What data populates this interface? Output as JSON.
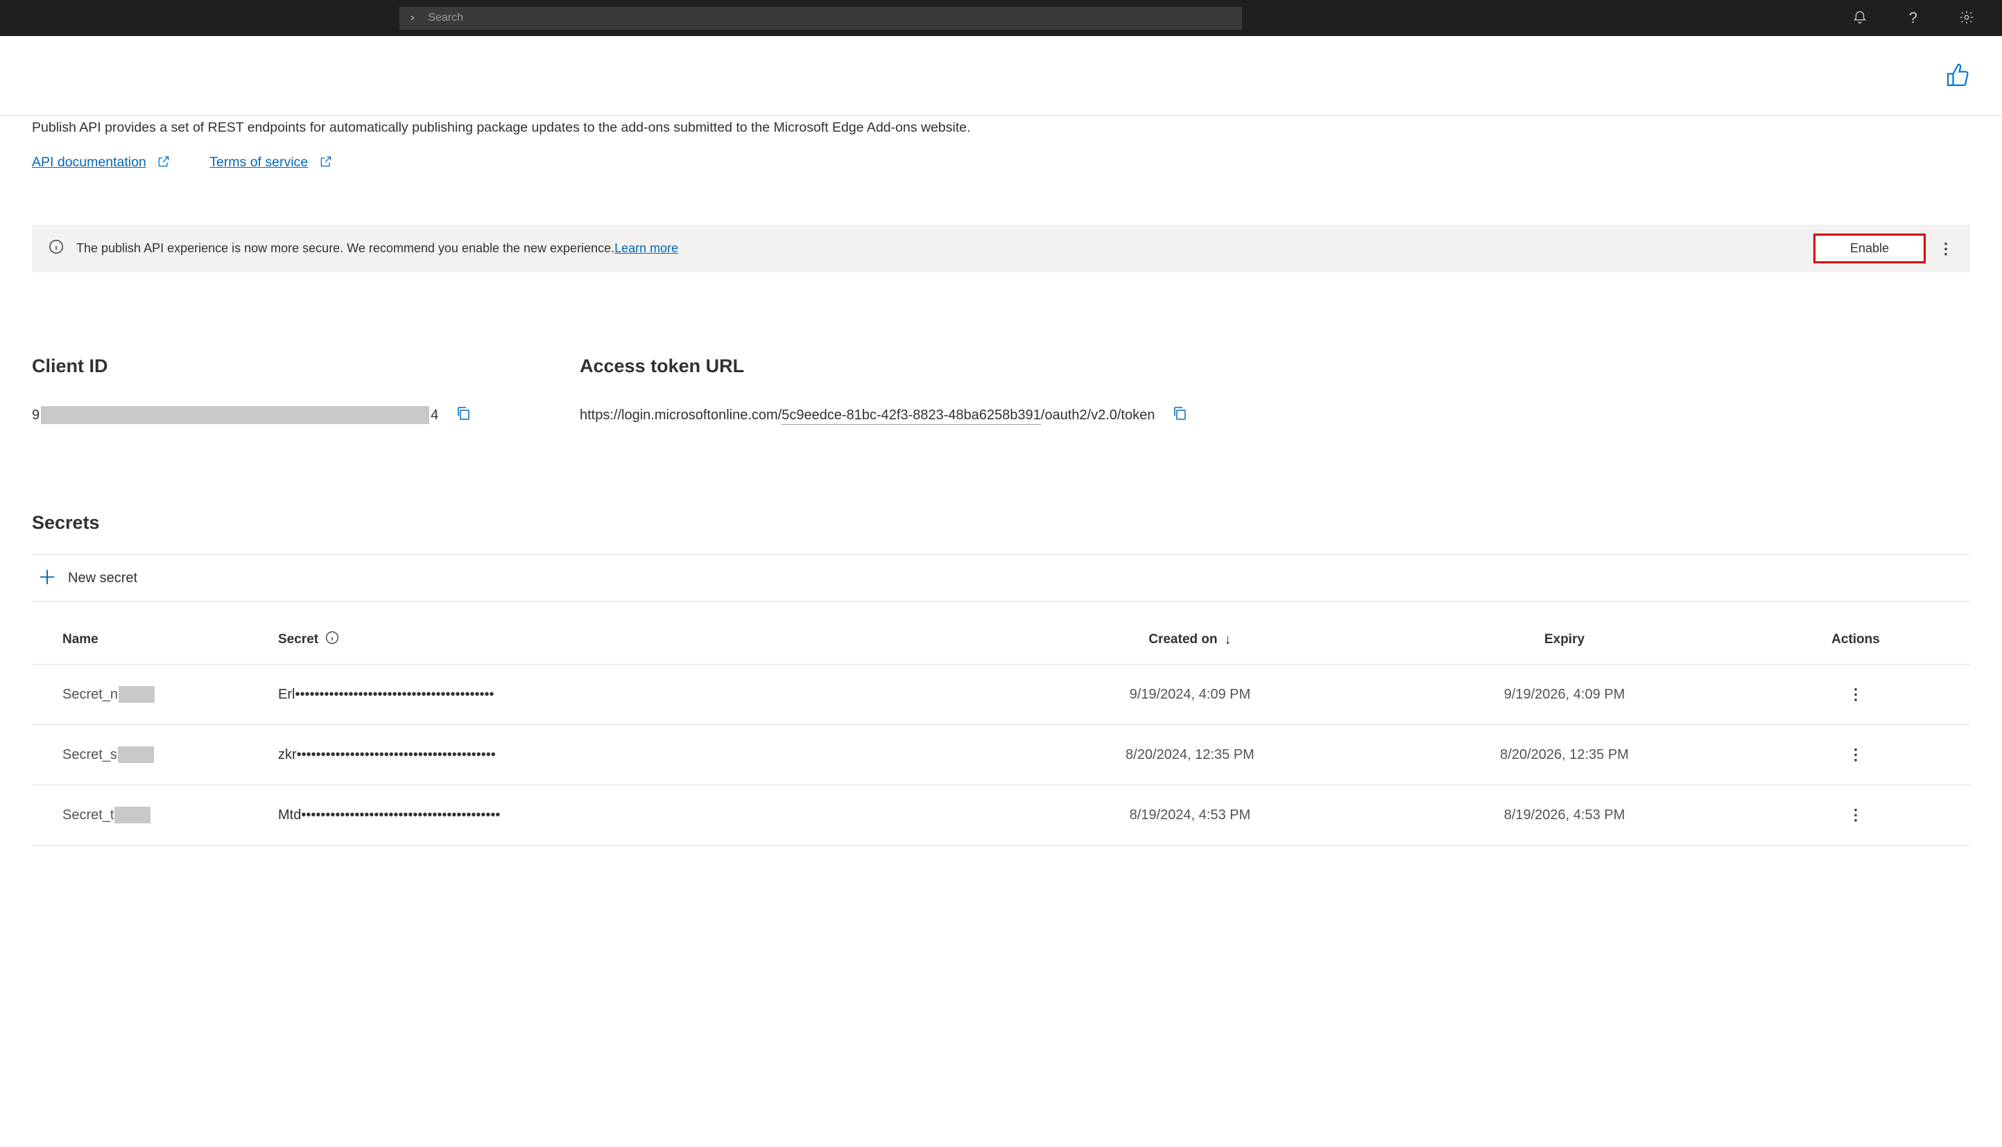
{
  "header": {
    "search_placeholder": "Search"
  },
  "intro": "Publish API provides a set of REST endpoints for automatically publishing package updates to the add-ons submitted to the Microsoft Edge Add-ons website.",
  "links": {
    "api_doc": "API documentation",
    "tos": "Terms of service"
  },
  "banner": {
    "text": "The publish API experience is now more secure. We recommend you enable the new experience. ",
    "learn_more": "Learn more",
    "enable": "Enable"
  },
  "client_id": {
    "heading": "Client ID",
    "prefix": "9",
    "suffix": "4"
  },
  "token": {
    "heading": "Access token URL",
    "url_prefix": "https://login.microsoftonline.com/",
    "tenant": "5c9eedce-81bc-42f3-8823-48ba6258b391",
    "url_suffix": "/oauth2/v2.0/token"
  },
  "secrets": {
    "heading": "Secrets",
    "new_label": "New secret",
    "columns": {
      "name": "Name",
      "secret": "Secret",
      "created": "Created on",
      "expiry": "Expiry",
      "actions": "Actions"
    },
    "rows": [
      {
        "name_prefix": "Secret_n",
        "secret_prefix": "Erl",
        "created": "9/19/2024, 4:09 PM",
        "expiry": "9/19/2026, 4:09 PM"
      },
      {
        "name_prefix": "Secret_s",
        "secret_prefix": "zkr",
        "created": "8/20/2024, 12:35 PM",
        "expiry": "8/20/2026, 12:35 PM"
      },
      {
        "name_prefix": "Secret_t",
        "secret_prefix": "Mtd",
        "created": "8/19/2024, 4:53 PM",
        "expiry": "8/19/2026, 4:53 PM"
      }
    ]
  }
}
